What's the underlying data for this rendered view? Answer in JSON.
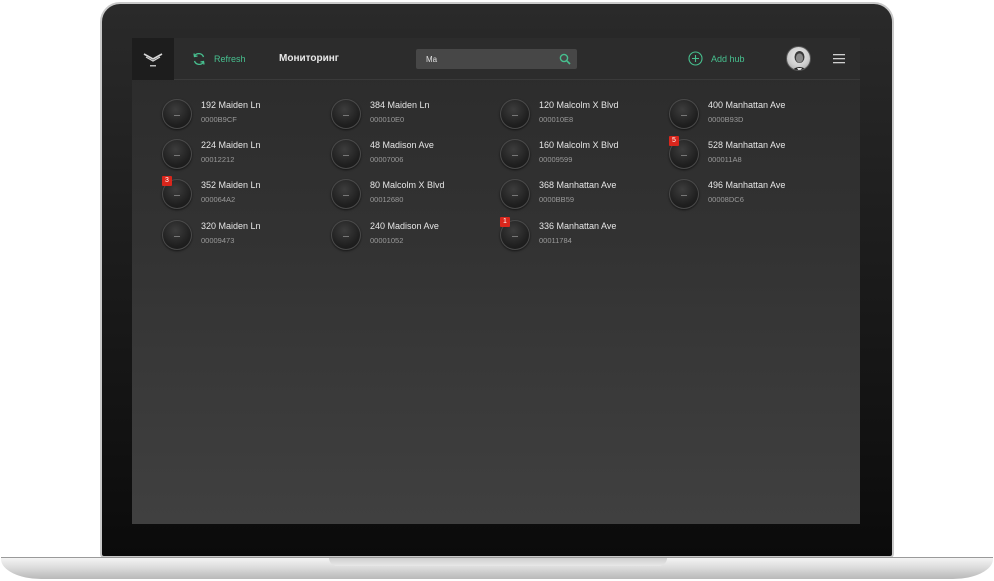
{
  "header": {
    "refresh_label": "Refresh",
    "title": "Мониторинг",
    "search_value": "Ma",
    "add_hub_label": "Add hub"
  },
  "colors": {
    "accent": "#47c08f",
    "badge": "#d9261c",
    "background": "#333333"
  },
  "icons": [
    "logo-icon",
    "refresh-icon",
    "search-icon",
    "add-icon",
    "menu-icon"
  ],
  "hubs": [
    {
      "name": "192 Maiden Ln",
      "serial": "0000B9CF",
      "badge": ""
    },
    {
      "name": "384 Maiden Ln",
      "serial": "000010E0",
      "badge": ""
    },
    {
      "name": "120 Malcolm X Blvd",
      "serial": "000010E8",
      "badge": ""
    },
    {
      "name": "400 Manhattan Ave",
      "serial": "0000B93D",
      "badge": ""
    },
    {
      "name": "224 Maiden Ln",
      "serial": "00012212",
      "badge": ""
    },
    {
      "name": "48 Madison Ave",
      "serial": "00007006",
      "badge": ""
    },
    {
      "name": "160 Malcolm X Blvd",
      "serial": "00009599",
      "badge": ""
    },
    {
      "name": "528 Manhattan Ave",
      "serial": "000011A8",
      "badge": "5"
    },
    {
      "name": "352 Maiden Ln",
      "serial": "000064A2",
      "badge": "3"
    },
    {
      "name": "80 Malcolm X Blvd",
      "serial": "00012680",
      "badge": ""
    },
    {
      "name": "368 Manhattan Ave",
      "serial": "0000BB59",
      "badge": ""
    },
    {
      "name": "496 Manhattan Ave",
      "serial": "00008DC6",
      "badge": ""
    },
    {
      "name": "320 Maiden Ln",
      "serial": "00009473",
      "badge": ""
    },
    {
      "name": "240 Madison Ave",
      "serial": "00001052",
      "badge": ""
    },
    {
      "name": "336 Manhattan Ave",
      "serial": "00011784",
      "badge": "1"
    }
  ]
}
